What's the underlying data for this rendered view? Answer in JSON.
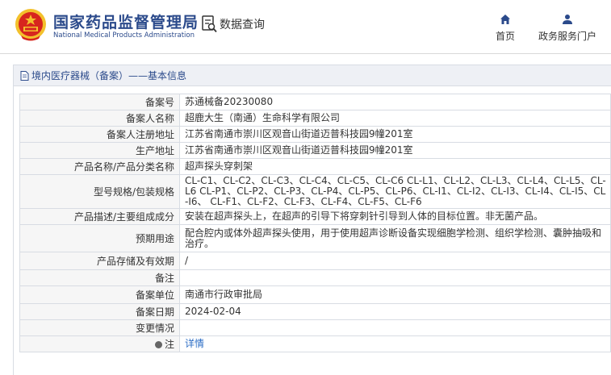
{
  "header": {
    "title": "国家药品监督管理局",
    "subtitle": "National Medical Products Administration",
    "data_query_label": "数据查询",
    "nav": [
      {
        "label": "首页",
        "icon": "home-icon"
      },
      {
        "label": "政务服务门户",
        "icon": "user-icon"
      }
    ]
  },
  "panel": {
    "breadcrumb": "境内医疗器械（备案）——基本信息"
  },
  "rows": [
    {
      "label": "备案号",
      "value": "苏通械备20230080"
    },
    {
      "label": "备案人名称",
      "value": "超鹿大生（南通）生命科学有限公司"
    },
    {
      "label": "备案人注册地址",
      "value": "江苏省南通市崇川区观音山街道迈普科技园9幢201室"
    },
    {
      "label": "生产地址",
      "value": "江苏省南通市崇川区观音山街道迈普科技园9幢201室"
    },
    {
      "label": "产品名称/产品分类名称",
      "value": "超声探头穿刺架"
    },
    {
      "label": "型号规格/包装规格",
      "value": "CL-C1、CL-C2、CL-C3、CL-C4、CL-C5、CL-C6 CL-L1、CL-L2、CL-L3、CL-L4、CL-L5、CL-L6 CL-P1、CL-P2、CL-P3、CL-P4、CL-P5、CL-P6、CL-I1、CL-I2、CL-I3、CL-I4、CL-I5、CL-I6、 CL-F1、CL-F2、CL-F3、CL-F4、CL-F5、CL-F6"
    },
    {
      "label": "产品描述/主要组成成分",
      "value": "安装在超声探头上，在超声的引导下将穿刺针引导到人体的目标位置。非无菌产品。"
    },
    {
      "label": "预期用途",
      "value": "配合腔内或体外超声探头使用，用于使用超声诊断设备实现细胞学检测、组织学检测、囊肿抽吸和治疗。"
    },
    {
      "label": "产品存储及有效期",
      "value": "/"
    },
    {
      "label": "备注",
      "value": ""
    },
    {
      "label": "备案单位",
      "value": "南通市行政审批局"
    },
    {
      "label": "备案日期",
      "value": "2024-02-04"
    },
    {
      "label": "变更情况",
      "value": ""
    },
    {
      "label": "注",
      "value": "详情"
    }
  ],
  "colors": {
    "brand_blue": "#2b4a8b",
    "link_blue": "#2b6dc5",
    "emblem_red": "#d7261e",
    "emblem_gold": "#f3c12c"
  }
}
